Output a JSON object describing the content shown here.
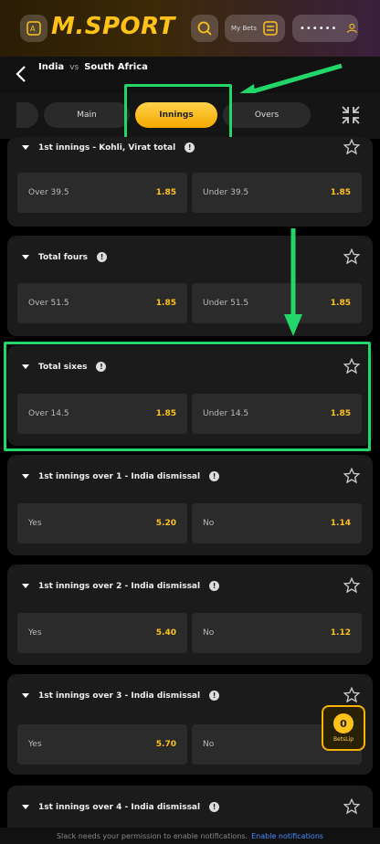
{
  "header": {
    "logo_text": "M.SPORT",
    "mybets_label": "My Bets",
    "password_mask": "••••••"
  },
  "match": {
    "team_home": "India",
    "vs": "vs",
    "team_away": "South Africa"
  },
  "tabs": [
    {
      "label": "Main"
    },
    {
      "label": "Innings"
    },
    {
      "label": "Overs"
    }
  ],
  "markets": [
    {
      "title": "1st innings - Kohli, Virat total",
      "options": [
        {
          "label": "Over 39.5",
          "odd": "1.85"
        },
        {
          "label": "Under 39.5",
          "odd": "1.85"
        }
      ]
    },
    {
      "title": "Total fours",
      "options": [
        {
          "label": "Over 51.5",
          "odd": "1.85"
        },
        {
          "label": "Under 51.5",
          "odd": "1.85"
        }
      ]
    },
    {
      "title": "Total sixes",
      "options": [
        {
          "label": "Over 14.5",
          "odd": "1.85"
        },
        {
          "label": "Under 14.5",
          "odd": "1.85"
        }
      ]
    },
    {
      "title": "1st innings over 1 - India dismissal",
      "options": [
        {
          "label": "Yes",
          "odd": "5.20"
        },
        {
          "label": "No",
          "odd": "1.14"
        }
      ]
    },
    {
      "title": "1st innings over 2 - India dismissal",
      "options": [
        {
          "label": "Yes",
          "odd": "5.40"
        },
        {
          "label": "No",
          "odd": "1.12"
        }
      ]
    },
    {
      "title": "1st innings over 3 - India dismissal",
      "options": [
        {
          "label": "Yes",
          "odd": "5.70"
        },
        {
          "label": "No",
          "odd": ""
        }
      ]
    },
    {
      "title": "1st innings over 4 - India dismissal",
      "options": []
    }
  ],
  "betslip": {
    "count": "0",
    "label": "BetsLip"
  },
  "notification": {
    "text": "Slack needs your permission to enable notifications.",
    "link": "Enable notifications"
  },
  "colors": {
    "accent": "#ffc21a",
    "highlight": "#22d66a",
    "card": "#1b1b1b",
    "odd_bg": "#2b2b2b"
  }
}
